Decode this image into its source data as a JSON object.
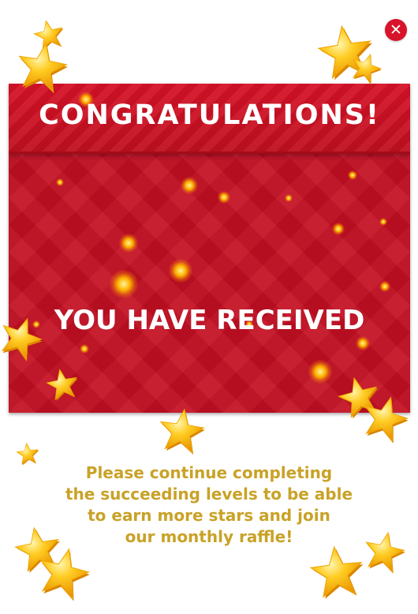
{
  "dialog": {
    "title": "CONGRATULATIONS!",
    "headline": "YOU HAVE RECEIVED",
    "message_lines": [
      "Please continue completing",
      "the succeeding levels to be able",
      "to earn more stars and join",
      "our monthly raffle!"
    ],
    "close_icon": "close-icon"
  },
  "colors": {
    "card_red": "#c20f22",
    "message_gold": "#c9a227",
    "close_red": "#d8142a",
    "star_gold": "#ffc21a"
  }
}
